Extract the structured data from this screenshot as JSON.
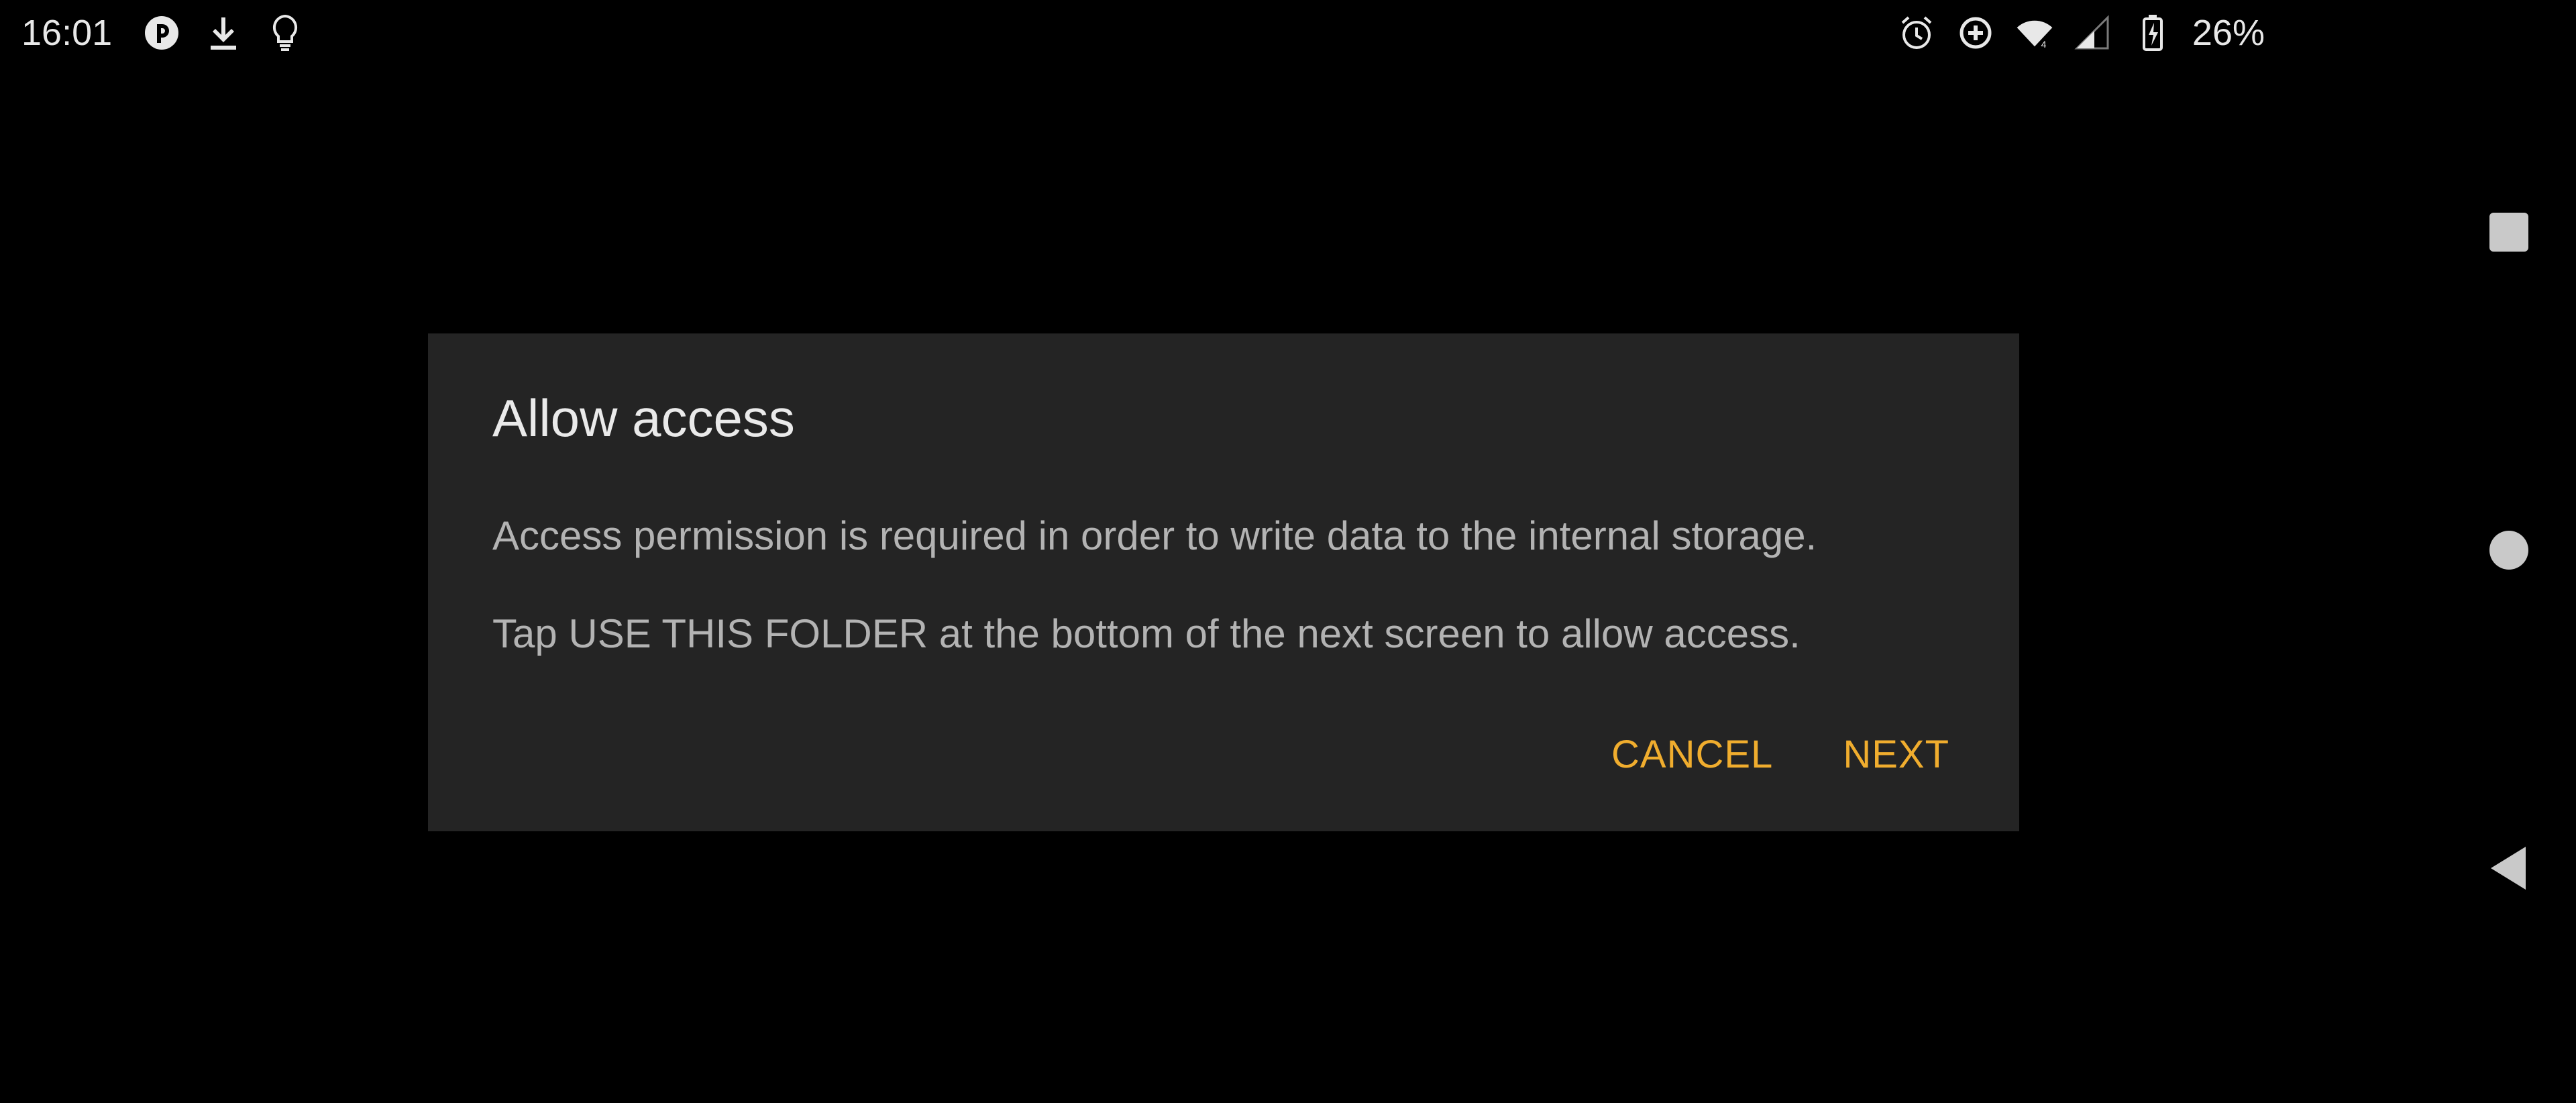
{
  "status_bar": {
    "time": "16:01",
    "battery_percent": "26%",
    "left_icons": [
      "notification-app-icon",
      "download-icon",
      "lightbulb-icon"
    ],
    "right_icons": [
      "alarm-icon",
      "data-saver-icon",
      "wifi-icon",
      "cellular-signal-icon",
      "battery-charging-icon"
    ]
  },
  "dialog": {
    "title": "Allow access",
    "message_1": "Access permission is required in order to write data to the internal storage.",
    "message_2": "Tap USE THIS FOLDER at the bottom of the next screen to allow access.",
    "cancel_label": "CANCEL",
    "next_label": "NEXT"
  },
  "colors": {
    "background": "#000000",
    "dialog_background": "#242424",
    "accent": "#f0ad2e",
    "title_text": "#eaeaea",
    "body_text": "#b3b3b3"
  },
  "nav_bar": {
    "buttons": [
      "recents-button",
      "home-button",
      "back-button"
    ]
  }
}
